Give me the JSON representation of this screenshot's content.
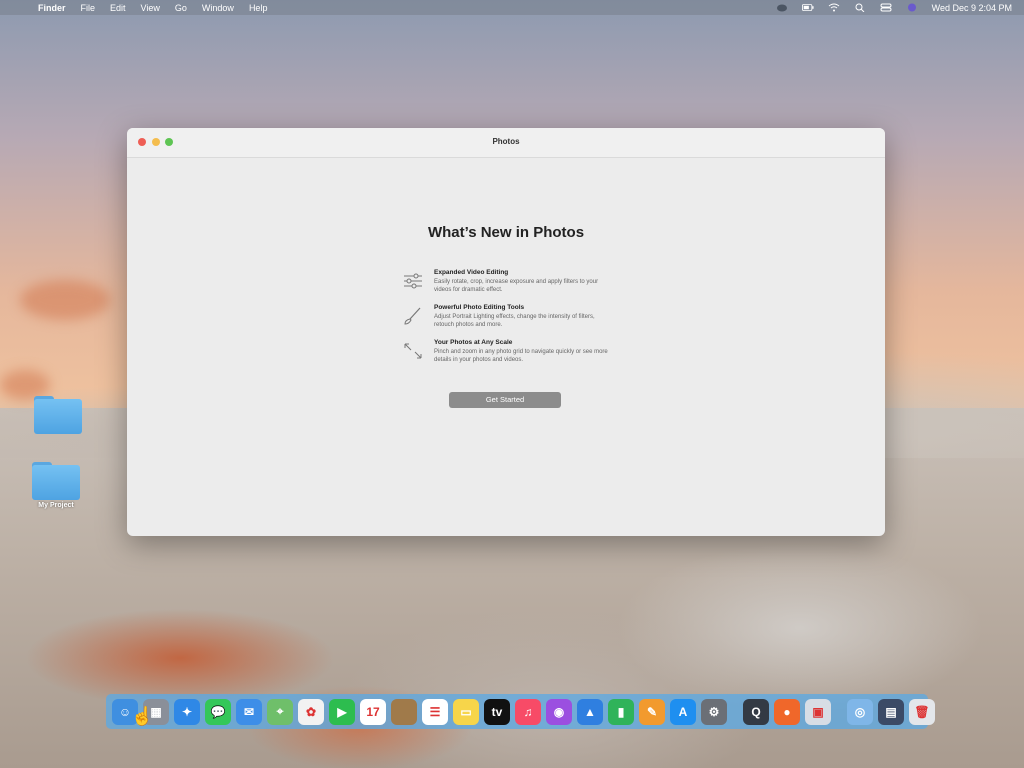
{
  "menubar": {
    "apple": "",
    "app_name": "Finder",
    "items": [
      "File",
      "Edit",
      "View",
      "Go",
      "Window",
      "Help"
    ],
    "clock": "Wed Dec 9  2:04 PM"
  },
  "window": {
    "title": "Photos",
    "heading": "What’s New in Photos",
    "features": [
      {
        "icon": "sliders-icon",
        "title": "Expanded Video Editing",
        "desc": "Easily rotate, crop, increase exposure and apply filters to your videos for dramatic effect."
      },
      {
        "icon": "brush-icon",
        "title": "Powerful Photo Editing Tools",
        "desc": "Adjust Portrait Lighting effects, change the intensity of filters, retouch photos and more."
      },
      {
        "icon": "arrows-expand-icon",
        "title": "Your Photos at Any Scale",
        "desc": "Pinch and zoom in any photo grid to navigate quickly or see more details in your photos and videos."
      }
    ],
    "button": "Get Started"
  },
  "desktop": {
    "folders": [
      {
        "label": ""
      },
      {
        "label": "My Project"
      }
    ]
  },
  "dock": {
    "apps": [
      {
        "name": "finder-icon",
        "glyph": "☺",
        "color": "#3f8fe0"
      },
      {
        "name": "launchpad-icon",
        "glyph": "▦",
        "color": "#8a8f99"
      },
      {
        "name": "safari-icon",
        "glyph": "✦",
        "color": "#2f88e6"
      },
      {
        "name": "messages-icon",
        "glyph": "💬",
        "color": "#34c759"
      },
      {
        "name": "mail-icon",
        "glyph": "✉",
        "color": "#3d8ee8"
      },
      {
        "name": "maps-icon",
        "glyph": "⌖",
        "color": "#6fbf6a"
      },
      {
        "name": "photos-icon",
        "glyph": "✿",
        "color": "#f2f2f2"
      },
      {
        "name": "facetime-icon",
        "glyph": "▶",
        "color": "#2dbd4f"
      },
      {
        "name": "calendar-icon",
        "glyph": "17",
        "color": "#ffffff"
      },
      {
        "name": "notes-brown-icon",
        "glyph": "",
        "color": "#a07a4a"
      },
      {
        "name": "reminders-icon",
        "glyph": "☰",
        "color": "#ffffff"
      },
      {
        "name": "notes-icon",
        "glyph": "▭",
        "color": "#f7d54a"
      },
      {
        "name": "tv-icon",
        "glyph": "tv",
        "color": "#111111"
      },
      {
        "name": "music-icon",
        "glyph": "♫",
        "color": "#f74b67"
      },
      {
        "name": "podcasts-icon",
        "glyph": "◉",
        "color": "#9b4fe0"
      },
      {
        "name": "keynote-icon",
        "glyph": "▲",
        "color": "#2f7fe0"
      },
      {
        "name": "numbers-icon",
        "glyph": "▮",
        "color": "#2fb35a"
      },
      {
        "name": "pages-icon",
        "glyph": "✎",
        "color": "#f29a2e"
      },
      {
        "name": "app-store-icon",
        "glyph": "A",
        "color": "#1e8ff0"
      },
      {
        "name": "system-preferences-icon",
        "glyph": "⚙",
        "color": "#6b6f76"
      },
      {
        "name": "quicktime-icon",
        "glyph": "Q",
        "color": "#333a44"
      },
      {
        "name": "firefox-icon",
        "glyph": "●",
        "color": "#f0672a"
      },
      {
        "name": "preview-icon",
        "glyph": "▣",
        "color": "#d7dde5"
      },
      {
        "name": "downloads-stack-icon",
        "glyph": "◎",
        "color": "#7fb6e8"
      },
      {
        "name": "window-stack-icon",
        "glyph": "▤",
        "color": "#3b4a66"
      },
      {
        "name": "trash-icon",
        "glyph": "🗑",
        "color": "#e3e6ea"
      }
    ]
  }
}
